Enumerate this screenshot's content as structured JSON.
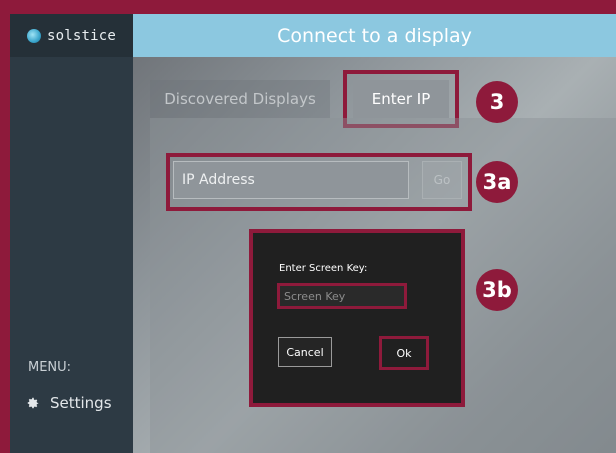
{
  "app": {
    "logo_text": "solstice",
    "title": "Connect to a display"
  },
  "sidebar": {
    "menu_label": "MENU:",
    "settings_label": "Settings"
  },
  "tabs": {
    "discovered": "Discovered Displays",
    "enter_ip": "Enter IP"
  },
  "ip_form": {
    "placeholder": "IP Address",
    "go_label": "Go"
  },
  "screen_key_dialog": {
    "label": "Enter Screen Key:",
    "placeholder": "Screen Key",
    "cancel_label": "Cancel",
    "ok_label": "Ok"
  },
  "callouts": {
    "step_3": "3",
    "step_3a": "3a",
    "step_3b": "3b"
  },
  "colors": {
    "accent": "#8e1a3b",
    "title_bar": "#8cc8e0",
    "sidebar": "#2d3a44"
  },
  "icons": {
    "logo": "solstice-logo-icon",
    "settings": "gear-icon"
  }
}
